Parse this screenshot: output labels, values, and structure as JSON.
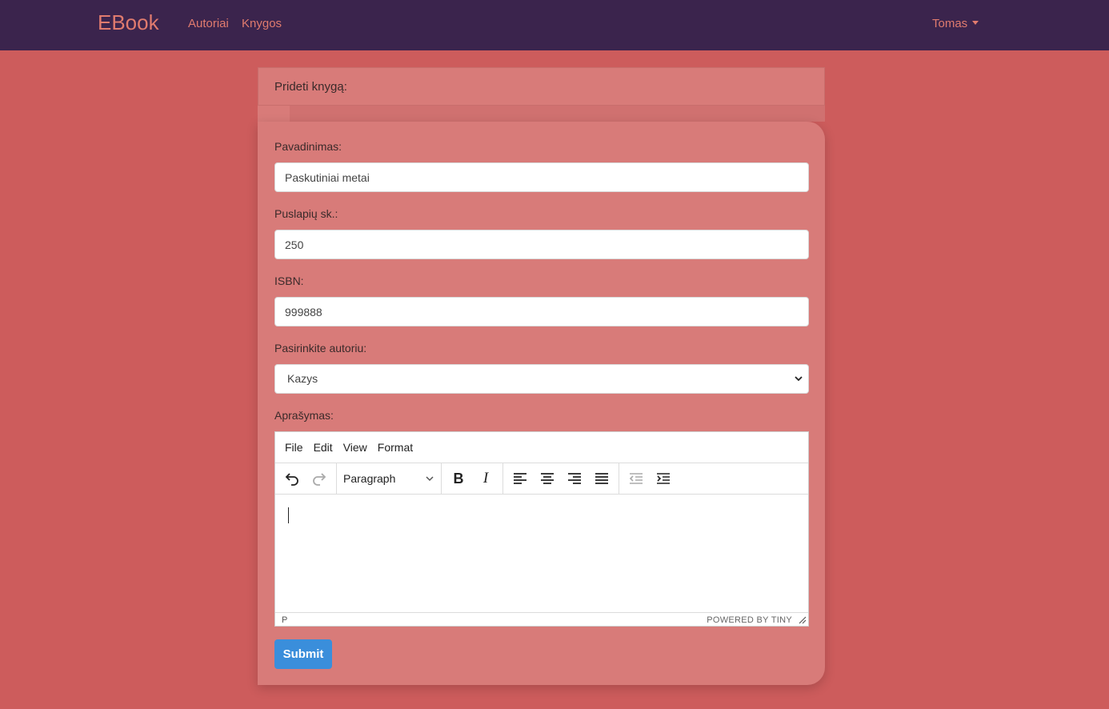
{
  "navbar": {
    "brand": "EBook",
    "links": [
      "Autoriai",
      "Knygos"
    ],
    "user": "Tomas"
  },
  "card": {
    "header": "Prideti knygą:"
  },
  "form": {
    "title_label": "Pavadinimas:",
    "title_value": "Paskutiniai metai",
    "pages_label": "Puslapių sk.:",
    "pages_value": "250",
    "isbn_label": "ISBN:",
    "isbn_value": "999888",
    "author_label": "Pasirinkite autoriu:",
    "author_selected": "Kazys",
    "description_label": "Aprašymas:",
    "submit_label": "Submit"
  },
  "editor": {
    "menu": [
      "File",
      "Edit",
      "View",
      "Format"
    ],
    "block_format": "Paragraph",
    "path": "P",
    "branding": "POWERED BY TINY"
  },
  "colors": {
    "background": "#cd5c5c",
    "navbar": "#3b244d",
    "accent": "#e07b6e",
    "submit": "#3a8edb"
  }
}
